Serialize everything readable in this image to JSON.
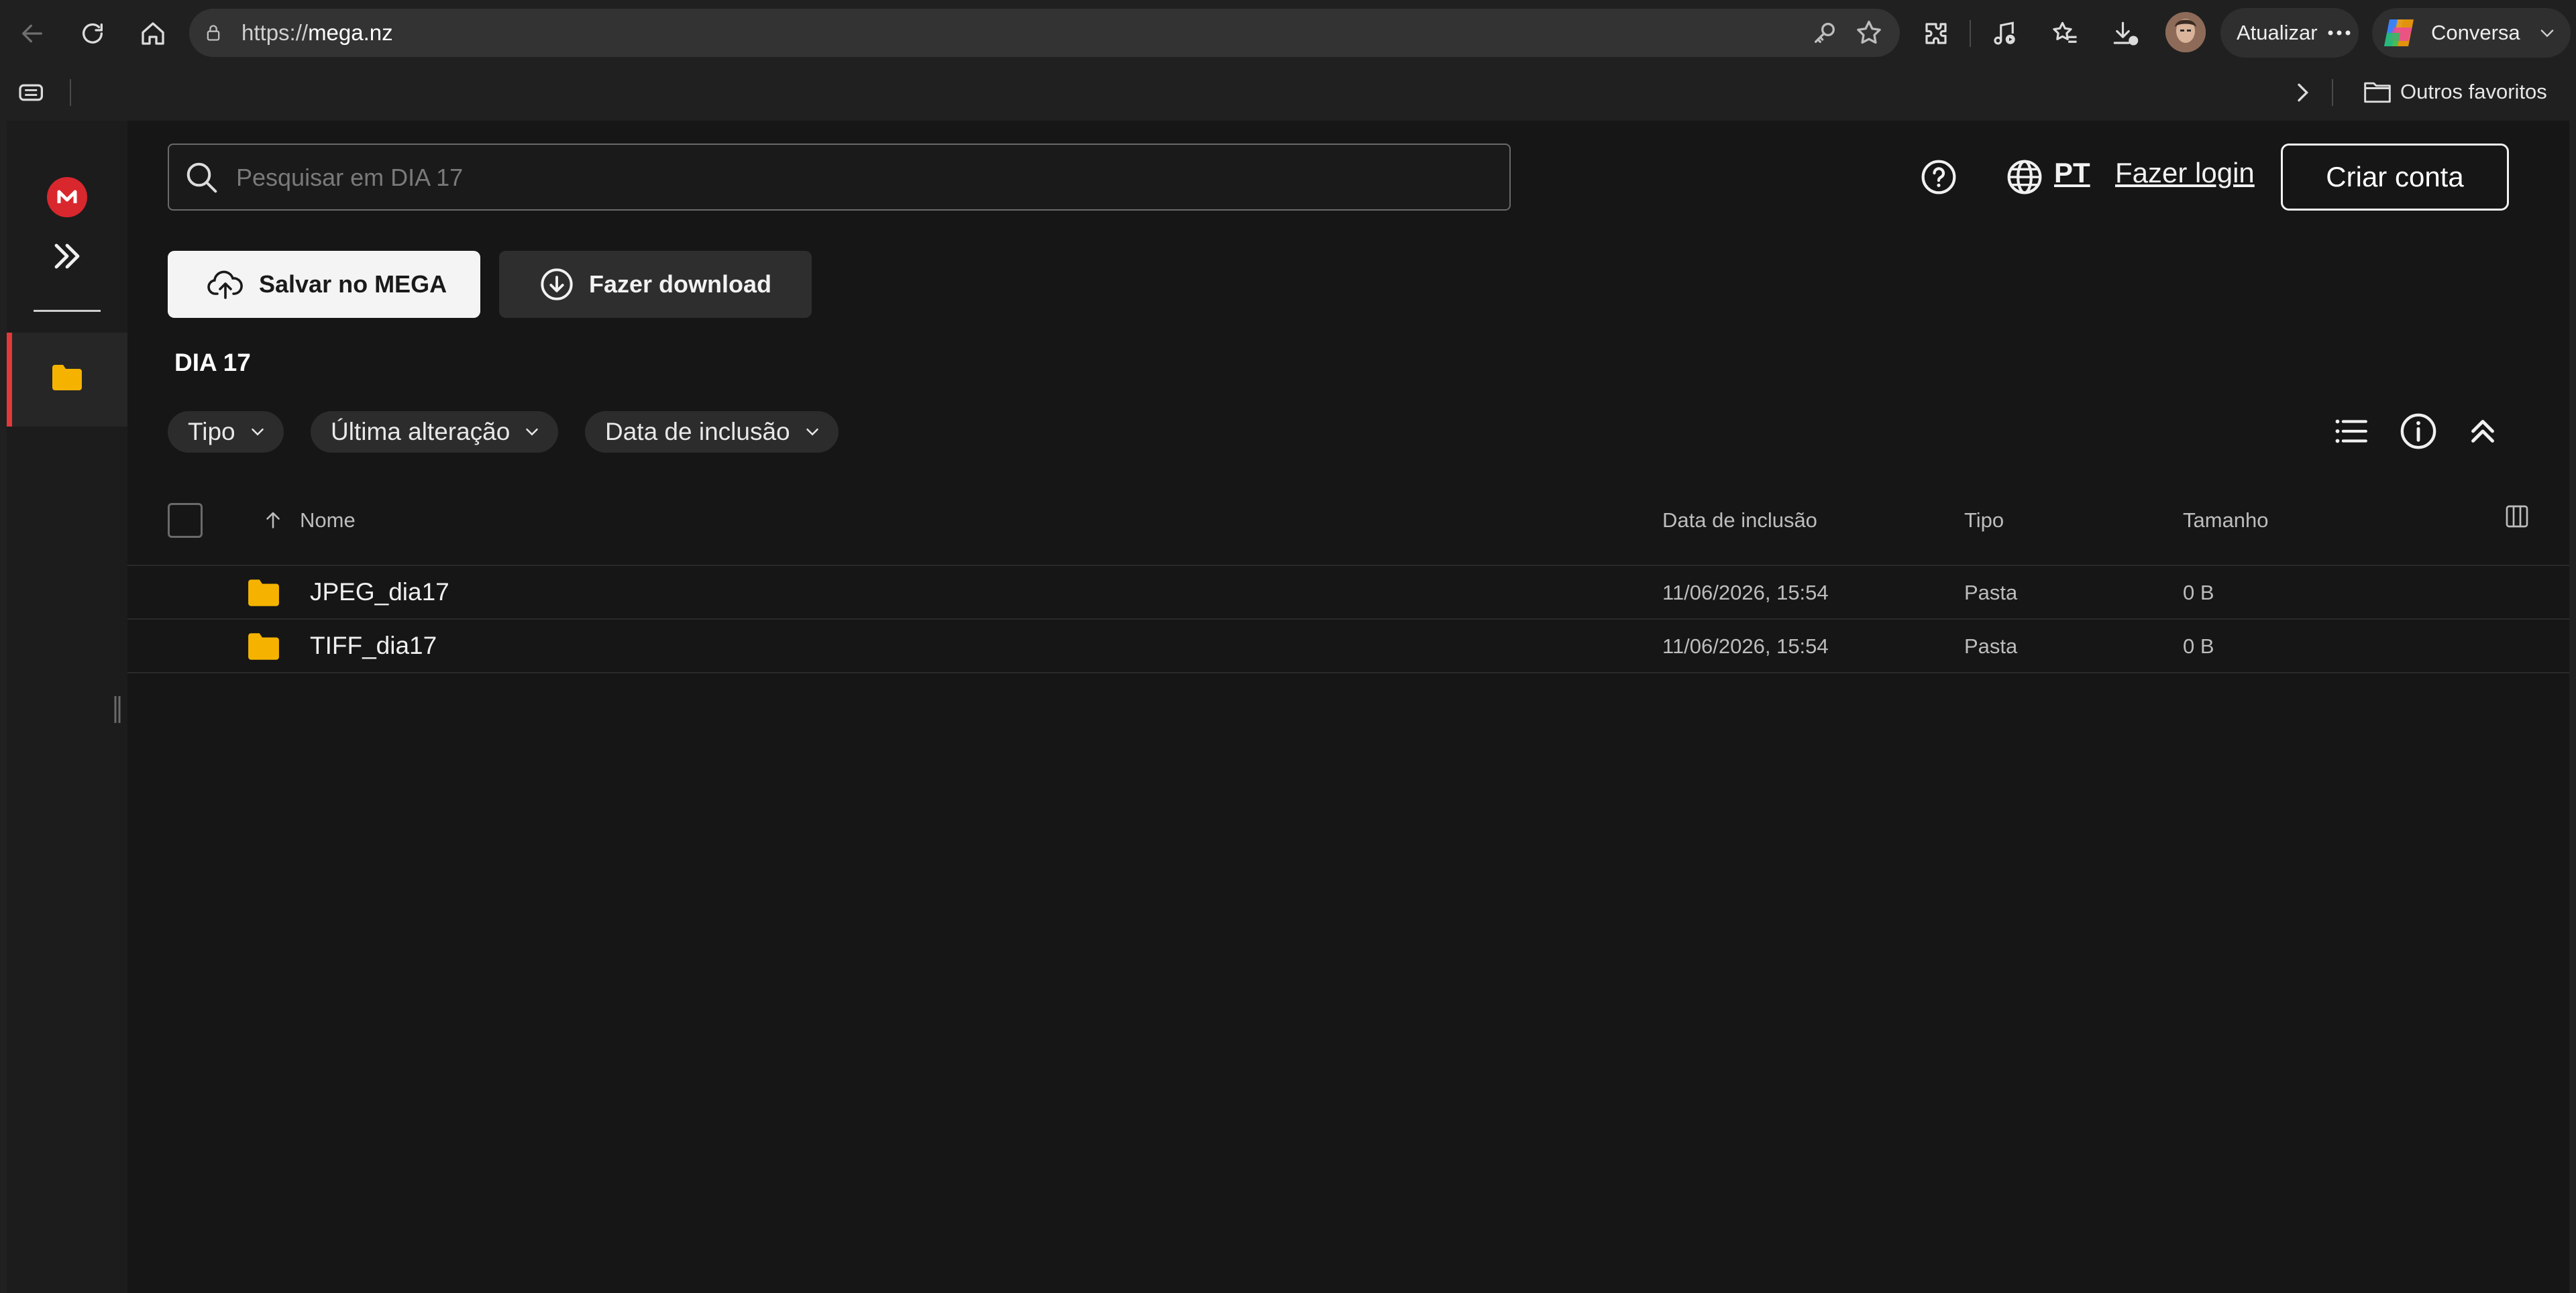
{
  "browser": {
    "url_prefix": "https://",
    "url_host": "mega.nz",
    "update_label": "Atualizar",
    "copilot_label": "Conversa",
    "favorites_label": "Outros favoritos"
  },
  "search": {
    "placeholder": "Pesquisar em DIA 17"
  },
  "header": {
    "language": "PT",
    "login_label": "Fazer login",
    "signup_label": "Criar conta"
  },
  "actions": {
    "save_label": "Salvar no MEGA",
    "download_label": "Fazer download"
  },
  "breadcrumb": "DIA 17",
  "filters": [
    "Tipo",
    "Última alteração",
    "Data de inclusão"
  ],
  "table": {
    "columns": {
      "name": "Nome",
      "date": "Data de inclusão",
      "type": "Tipo",
      "size": "Tamanho"
    },
    "rows": [
      {
        "name": "JPEG_dia17",
        "date": "11/06/2026, 15:54",
        "type": "Pasta",
        "size": "0 B"
      },
      {
        "name": "TIFF_dia17",
        "date": "11/06/2026, 15:54",
        "type": "Pasta",
        "size": "0 B"
      }
    ]
  },
  "colors": {
    "brand_red": "#d9272e",
    "folder_yellow": "#f5b300",
    "accent_bar": "#e03a3a"
  },
  "icons": [
    "back-icon",
    "refresh-icon",
    "home-icon",
    "lock-icon",
    "key-icon",
    "star-icon",
    "extensions-icon",
    "media-icon",
    "favorites-icon",
    "download-icon",
    "more-icon",
    "copilot-icon",
    "chevron-down-icon",
    "tab-actions-icon",
    "chevron-right-icon",
    "folder-icon",
    "help-icon",
    "globe-icon",
    "list-view-icon",
    "info-icon",
    "collapse-icon",
    "sort-up-icon",
    "columns-icon"
  ]
}
